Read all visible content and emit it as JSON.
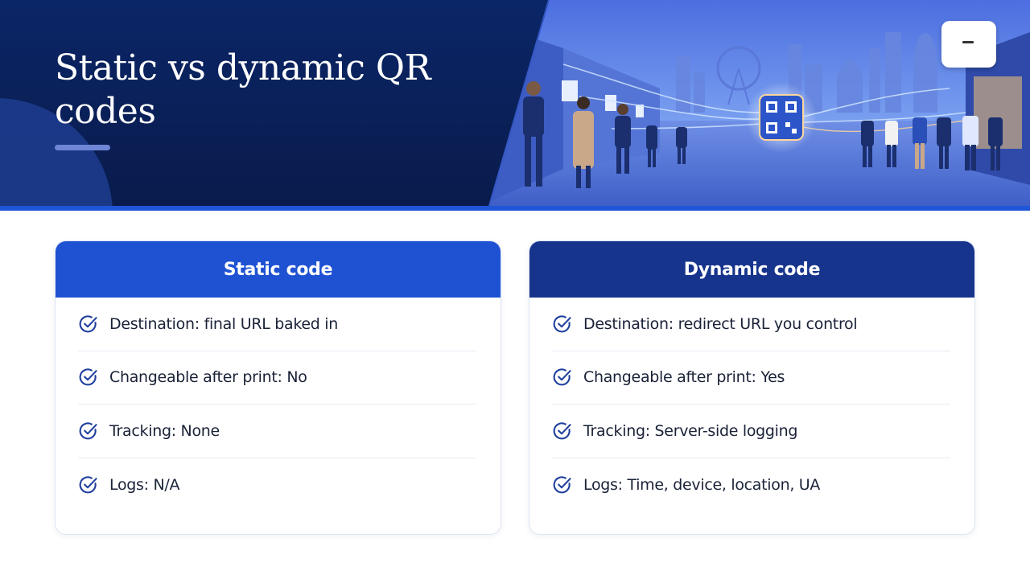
{
  "header": {
    "title": "Static vs dynamic QR codes"
  },
  "colors": {
    "banner_navy": "#0b2667",
    "static_header": "#1f52d3",
    "dynamic_header": "#17348d",
    "accent_line": "#1f56d8"
  },
  "cards": {
    "static": {
      "title": "Static code",
      "items": [
        "Destination: final URL baked in",
        "Changeable after print: No",
        "Tracking: None",
        "Logs: N/A"
      ]
    },
    "dynamic": {
      "title": "Dynamic code",
      "items": [
        "Destination: redirect URL you control",
        "Changeable after print: Yes",
        "Tracking: Server-side logging",
        "Logs: Time, device, location, UA"
      ]
    }
  },
  "icons": {
    "list_marker": "check-circle-icon",
    "hero": "qr-code-icon"
  }
}
